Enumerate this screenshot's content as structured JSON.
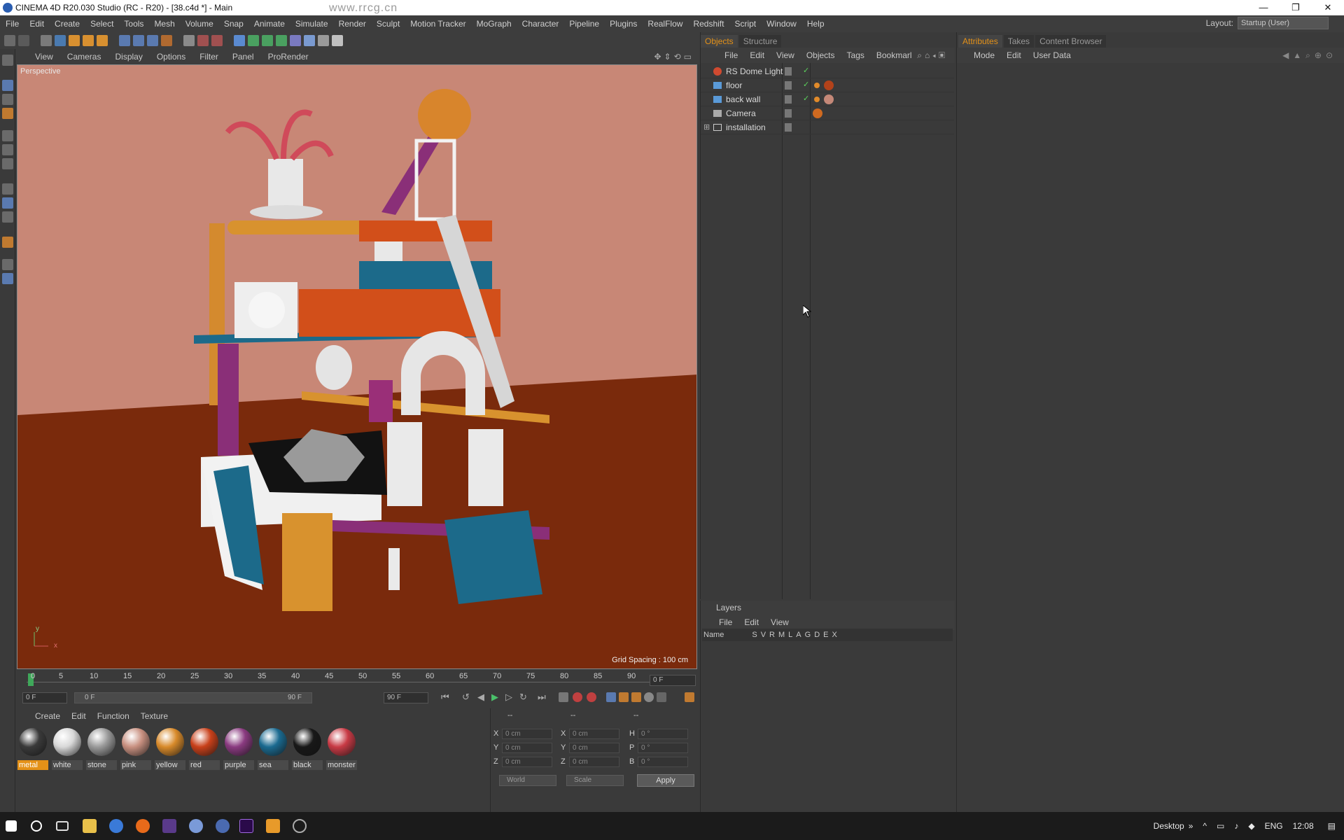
{
  "window": {
    "title": "CINEMA 4D R20.030 Studio (RC - R20) - [38.c4d *] - Main",
    "controls": {
      "minimize": "—",
      "restore": "❐",
      "close": "✕"
    }
  },
  "menubar": {
    "items": [
      "File",
      "Edit",
      "Create",
      "Select",
      "Tools",
      "Mesh",
      "Volume",
      "Snap",
      "Animate",
      "Simulate",
      "Render",
      "Sculpt",
      "Motion Tracker",
      "MoGraph",
      "Character",
      "Pipeline",
      "Plugins",
      "RealFlow",
      "Redshift",
      "Script",
      "Window",
      "Help"
    ],
    "layout_label": "Layout:",
    "layout_value": "Startup (User)"
  },
  "viewport": {
    "menu": [
      "View",
      "Cameras",
      "Display",
      "Options",
      "Filter",
      "Panel",
      "ProRender"
    ],
    "label": "Perspective",
    "grid_spacing": "Grid Spacing : 100 cm",
    "axis": {
      "y": "y",
      "x": "x"
    }
  },
  "timeline": {
    "ticks": [
      "0",
      "5",
      "10",
      "15",
      "20",
      "25",
      "30",
      "35",
      "40",
      "45",
      "50",
      "55",
      "60",
      "65",
      "70",
      "75",
      "80",
      "85",
      "90"
    ],
    "current_frame": "0 F",
    "start_field": "0 F",
    "range_start": "0 F",
    "range_end": "90 F",
    "end_field": "90 F"
  },
  "materials": {
    "menu": [
      "Create",
      "Edit",
      "Function",
      "Texture"
    ],
    "items": [
      {
        "name": "metal",
        "color": "#3a3a3a"
      },
      {
        "name": "white",
        "color": "#d8d8d8"
      },
      {
        "name": "stone",
        "color": "#9a9a9a"
      },
      {
        "name": "pink",
        "color": "#c89080"
      },
      {
        "name": "yellow",
        "color": "#d88a2a"
      },
      {
        "name": "red",
        "color": "#c8401a"
      },
      {
        "name": "purple",
        "color": "#8a3a80"
      },
      {
        "name": "sea",
        "color": "#1a6a90"
      },
      {
        "name": "black",
        "color": "#181818"
      },
      {
        "name": "monster",
        "color": "#c83a45"
      }
    ]
  },
  "coordinates": {
    "header_left": "--",
    "header_mid": "--",
    "header_right": "--",
    "rows": [
      {
        "a": "X",
        "av": "0 cm",
        "b": "X",
        "bv": "0 cm",
        "c": "H",
        "cv": "0 °"
      },
      {
        "a": "Y",
        "av": "0 cm",
        "b": "Y",
        "bv": "0 cm",
        "c": "P",
        "cv": "0 °"
      },
      {
        "a": "Z",
        "av": "0 cm",
        "b": "Z",
        "bv": "0 cm",
        "c": "B",
        "cv": "0 °"
      }
    ],
    "mode": "World",
    "size_mode": "Scale",
    "apply": "Apply"
  },
  "objects": {
    "tabs": [
      "Objects",
      "Structure"
    ],
    "menu": [
      "File",
      "Edit",
      "View",
      "Objects",
      "Tags",
      "Bookmarl"
    ],
    "items": [
      {
        "name": "RS Dome Light",
        "icon": "dome-light-icon"
      },
      {
        "name": "floor",
        "icon": "plane-icon"
      },
      {
        "name": "back wall",
        "icon": "plane-icon"
      },
      {
        "name": "Camera",
        "icon": "camera-icon"
      },
      {
        "name": "installation",
        "icon": "null-group-icon"
      }
    ]
  },
  "layers": {
    "title": "Layers",
    "menu": [
      "File",
      "Edit",
      "View"
    ],
    "columns": [
      "Name",
      "S",
      "V",
      "R",
      "M",
      "L",
      "A",
      "G",
      "D",
      "E",
      "X"
    ]
  },
  "attributes": {
    "tabs": [
      "Attributes",
      "Takes",
      "Content Browser"
    ],
    "menu": [
      "Mode",
      "Edit",
      "User Data"
    ]
  },
  "taskbar": {
    "desktop": "Desktop",
    "chevron": "»",
    "lang": "ENG",
    "time": "12:08"
  },
  "watermark": "www.rrcg.cn"
}
